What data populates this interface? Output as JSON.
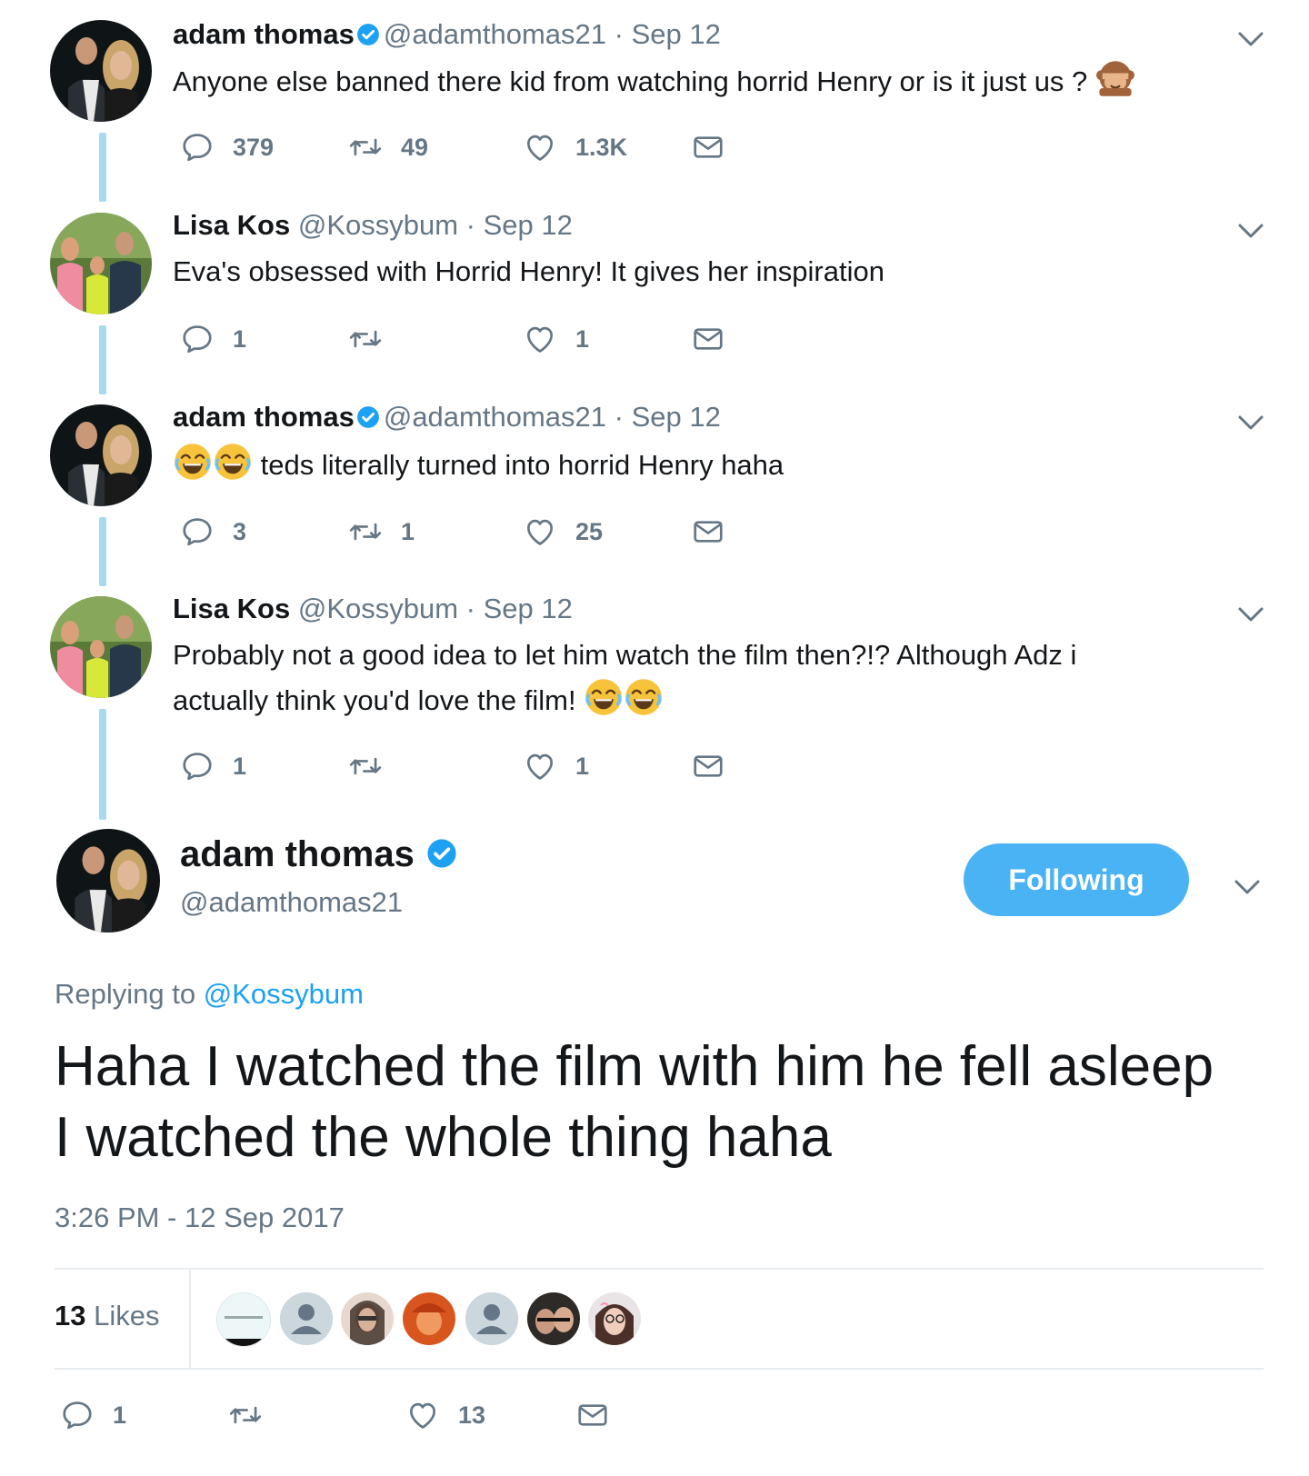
{
  "tweets": [
    {
      "name": "adam thomas",
      "verified": true,
      "handle": "@adamthomas21",
      "date": "Sep 12",
      "text": "Anyone else banned there kid from watching horrid Henry or is it just us ?",
      "emoji_after": "see-no-evil-monkey",
      "replies": "379",
      "retweets": "49",
      "likes": "1.3K"
    },
    {
      "name": "Lisa Kos",
      "verified": false,
      "handle": "@Kossybum",
      "date": "Sep 12",
      "text": "Eva's obsessed with Horrid Henry! It gives her inspiration",
      "replies": "1",
      "retweets": "",
      "likes": "1"
    },
    {
      "name": "adam thomas",
      "verified": true,
      "handle": "@adamthomas21",
      "date": "Sep 12",
      "emoji_before": "face-with-tears-of-joy x2",
      "text": "teds literally turned into horrid Henry haha",
      "replies": "3",
      "retweets": "1",
      "likes": "25"
    },
    {
      "name": "Lisa Kos",
      "verified": false,
      "handle": "@Kossybum",
      "date": "Sep 12",
      "text_line1": "Probably not a good idea to let him watch the film then?!? Although Adz i",
      "text_line2": "actually think you'd love the film!",
      "emoji_after": "face-with-tears-of-joy x2",
      "replies": "1",
      "retweets": "",
      "likes": "1"
    }
  ],
  "main_tweet": {
    "name": "adam thomas",
    "handle": "@adamthomas21",
    "follow_label": "Following",
    "replying_prefix": "Replying to",
    "replying_to": "@Kossybum",
    "text": "Haha I watched the film with him he fell asleep I watched the whole thing haha",
    "timestamp": "3:26 PM - 12 Sep 2017",
    "likes_number": "13",
    "likes_word": "Likes",
    "replies": "1",
    "retweets": "",
    "likes": "13"
  },
  "colors": {
    "accent": "#1da1f2",
    "follow_button": "#4ab3f4",
    "muted_text": "#657786",
    "thread_line": "#a9d8f2",
    "verified_badge": "#1da1f2"
  },
  "icons": [
    "reply-icon",
    "retweet-icon",
    "like-icon",
    "direct-message-icon",
    "chevron-down-icon",
    "verified-badge-icon"
  ]
}
